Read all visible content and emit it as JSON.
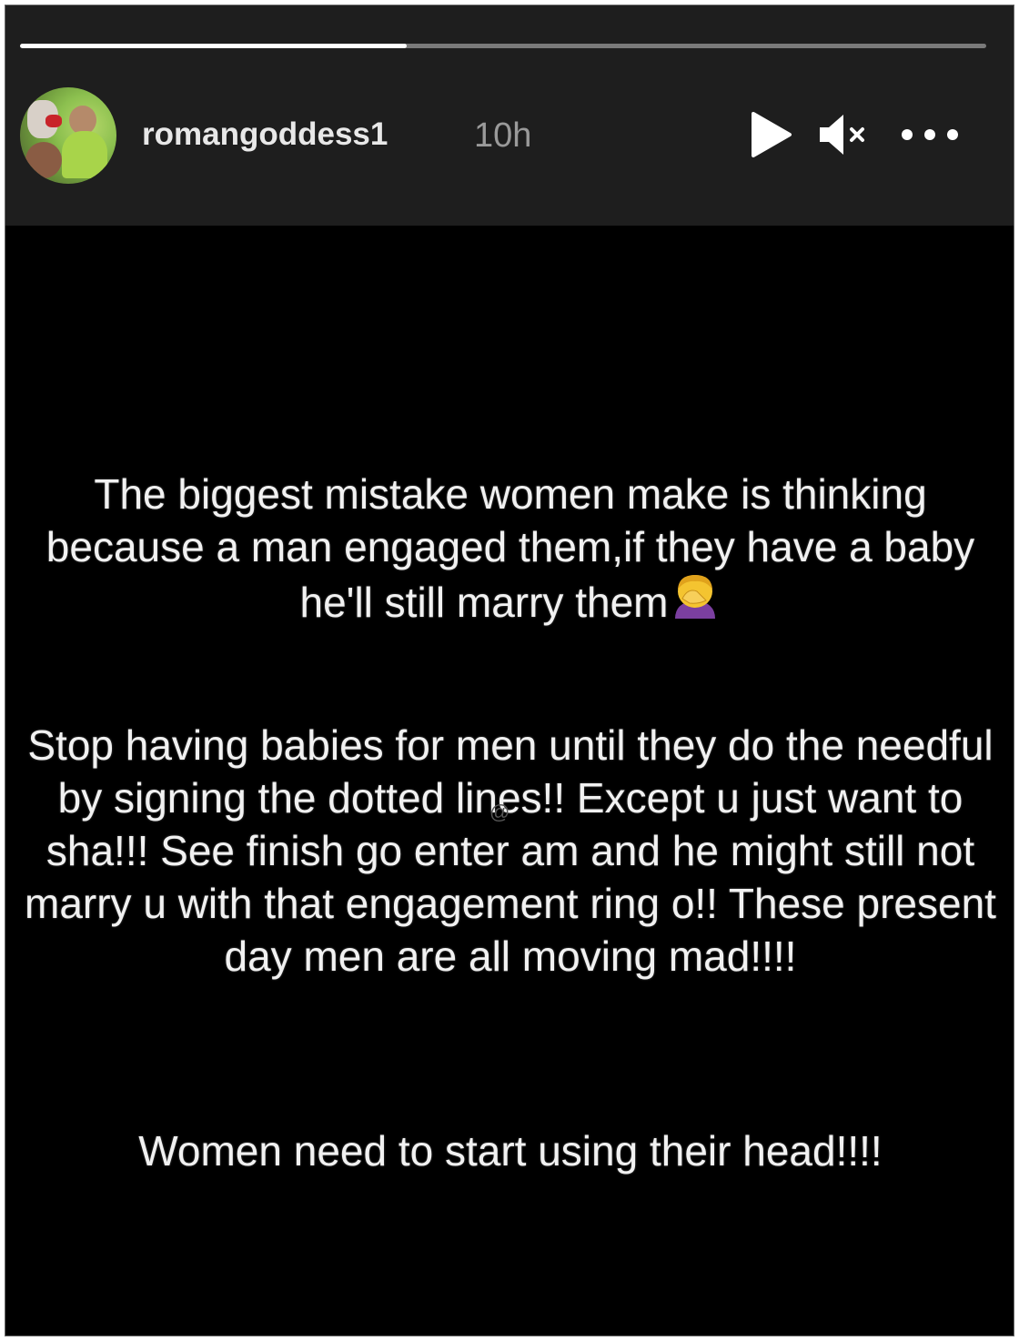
{
  "story": {
    "username": "romangoddess1",
    "timestamp": "10h",
    "progress_fraction": 0.4,
    "controls": {
      "play_icon": "play-icon",
      "mute_icon": "muted-speaker-icon",
      "more_icon": "more-options-icon"
    },
    "avatar": "profile-avatar"
  },
  "post": {
    "paragraph_1": "The biggest mistake women make is thinking because a man engaged them,if they have a baby he'll still marry them",
    "paragraph_1_emoji": "🤦‍♀️",
    "paragraph_2": "Stop having babies for men until they do the needful by signing the dotted lines!! Except u just want to sha!!! See finish go enter am and he might still not marry u with that engagement ring o!! These present day men are all moving mad!!!!",
    "paragraph_3": "Women need to start using their head!!!!",
    "watermark": "@"
  },
  "colors": {
    "header_bg": "#1e1e1e",
    "body_bg": "#000000",
    "text": "#f1f1f1",
    "timestamp": "#9a9a9a",
    "progress_track": "#7a7a7a",
    "progress_fill": "#ffffff"
  }
}
